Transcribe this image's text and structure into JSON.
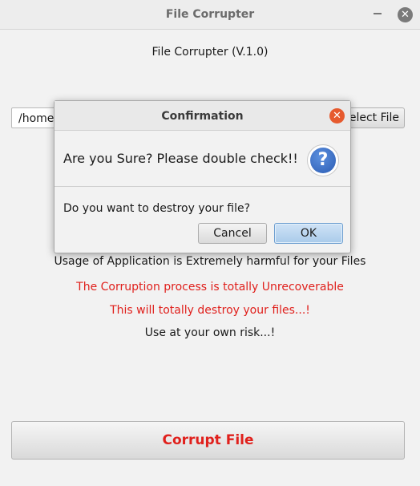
{
  "window": {
    "title": "File Corrupter",
    "minimize_glyph": "",
    "close_glyph": "✕"
  },
  "main": {
    "app_title": "File Corrupter (V.1.0)",
    "path_value": "/home/",
    "select_file_label": "Select File",
    "usage_text": "Usage of Application is Extremely harmful for your Files",
    "warning_1": "The Corruption process is totally Unrecoverable",
    "warning_2": "This will totally destroy your files...!",
    "risk_text": "Use at your own risk...!",
    "corrupt_button_label": "Corrupt File"
  },
  "dialog": {
    "title": "Confirmation",
    "close_glyph": "✕",
    "header_text": "Are you Sure? Please double check!!",
    "icon_glyph": "?",
    "content_text": "Do you want to destroy your file?",
    "cancel_label": "Cancel",
    "ok_label": "OK"
  },
  "colors": {
    "warning_red": "#e0201c",
    "ok_button_blue": "#a9cbea",
    "close_button_orange": "#e65a2e",
    "question_icon_blue": "#2b5cb3"
  }
}
